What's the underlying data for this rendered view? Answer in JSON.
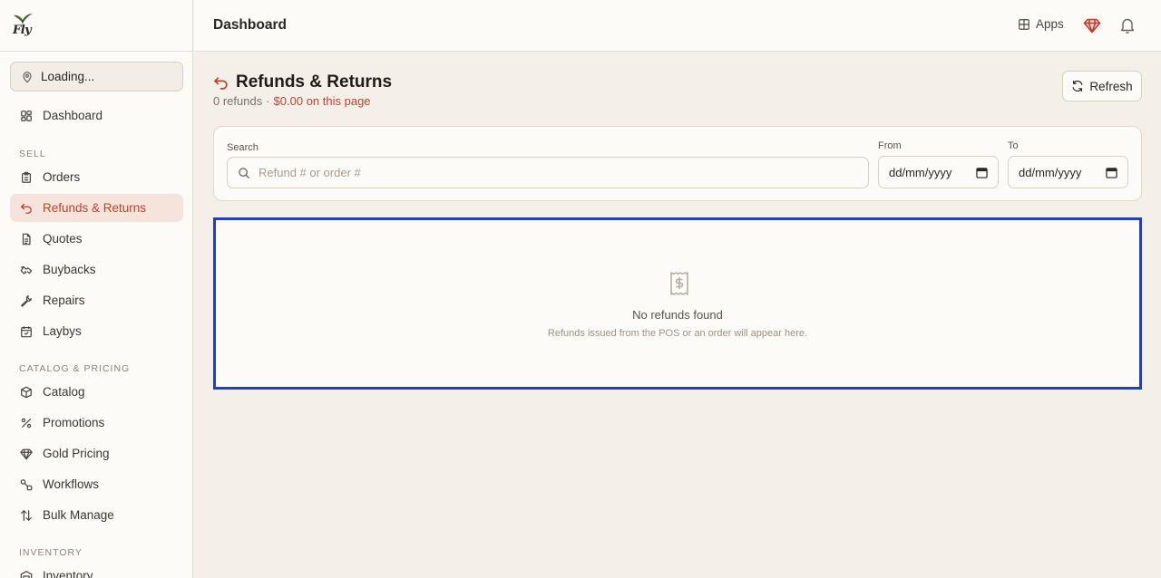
{
  "sidebar": {
    "logo_text": "Fly",
    "location_label": "Loading...",
    "dashboard": "Dashboard",
    "sections": [
      {
        "label": "SELL",
        "items": [
          "Orders",
          "Refunds & Returns",
          "Quotes",
          "Buybacks",
          "Repairs",
          "Laybys"
        ]
      },
      {
        "label": "CATALOG & PRICING",
        "items": [
          "Catalog",
          "Promotions",
          "Gold Pricing",
          "Workflows",
          "Bulk Manage"
        ]
      },
      {
        "label": "INVENTORY",
        "items": [
          "Inventory"
        ]
      }
    ],
    "active_item": "Refunds & Returns"
  },
  "header": {
    "title": "Dashboard",
    "apps_label": "Apps",
    "icons": [
      "grid-icon",
      "gem-icon",
      "bell-icon"
    ]
  },
  "page": {
    "title": "Refunds & Returns",
    "count_text": "0 refunds",
    "separator": "·",
    "amount_text": "$0.00 on this page",
    "refresh_label": "Refresh"
  },
  "filters": {
    "search_label": "Search",
    "search_placeholder": "Refund # or order #",
    "from_label": "From",
    "from_value": "dd/mm/yyyy",
    "to_label": "To",
    "to_value": "dd/mm/yyyy"
  },
  "empty_state": {
    "title": "No refunds found",
    "description": "Refunds issued from the POS or an order will appear here."
  },
  "colors": {
    "accent": "#b8442a",
    "active_bg": "#f6e3dc",
    "background": "#f5efe9",
    "panel": "#fdfbf8",
    "focus_border": "#1f3fc4"
  }
}
